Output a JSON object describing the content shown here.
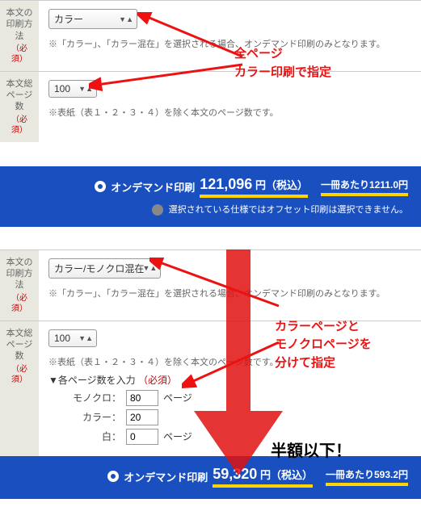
{
  "block1": {
    "label_print": "本文の\n印刷方\n法",
    "req": "（必\n須）",
    "select_color": "カラー",
    "color_note": "※「カラー」、「カラー混在」を選択される場合、オンデマンド印刷のみとなります。",
    "label_pages": "本文総\nページ\n数",
    "select_pages": "100",
    "pages_note": "※表紙（表１・２・３・４）を除く本文のページ数です。",
    "price_label": "オンデマンド印刷",
    "price_value": "121,096",
    "price_unit": "円（税込）",
    "per_book": "一冊あたり1211.0円",
    "disabled_msg": "選択されている仕様ではオフセット印刷は選択できません。"
  },
  "block2": {
    "label_print": "本文の\n印刷方\n法",
    "req": "（必\n須）",
    "select_mixed": "カラー/モノクロ混在",
    "color_note": "※「カラー」、「カラー混在」を選択される場合、オンデマンド印刷のみとなります。",
    "label_pages": "本文総\nページ\n数",
    "select_pages": "100",
    "pages_note": "※表紙（表１・２・３・４）を除く本文のページ数です。",
    "sub_head": "▼各ページ数を入力",
    "sub_req": "（必須）",
    "mono_label": "モノクロ：",
    "mono_val": "80",
    "color_label": "カラー：",
    "color_val": "20",
    "white_label": "白：",
    "white_val": "0",
    "page_suffix": "ページ",
    "price_label": "オンデマンド印刷",
    "price_value": "59,320",
    "price_unit": "円（税込）",
    "per_book": "一冊あたり593.2円"
  },
  "annot": {
    "a1": "全ページ\nカラー印刷で指定",
    "a2": "カラーページと\nモノクロページを\n分けて指定",
    "a3": "半額以下！"
  }
}
